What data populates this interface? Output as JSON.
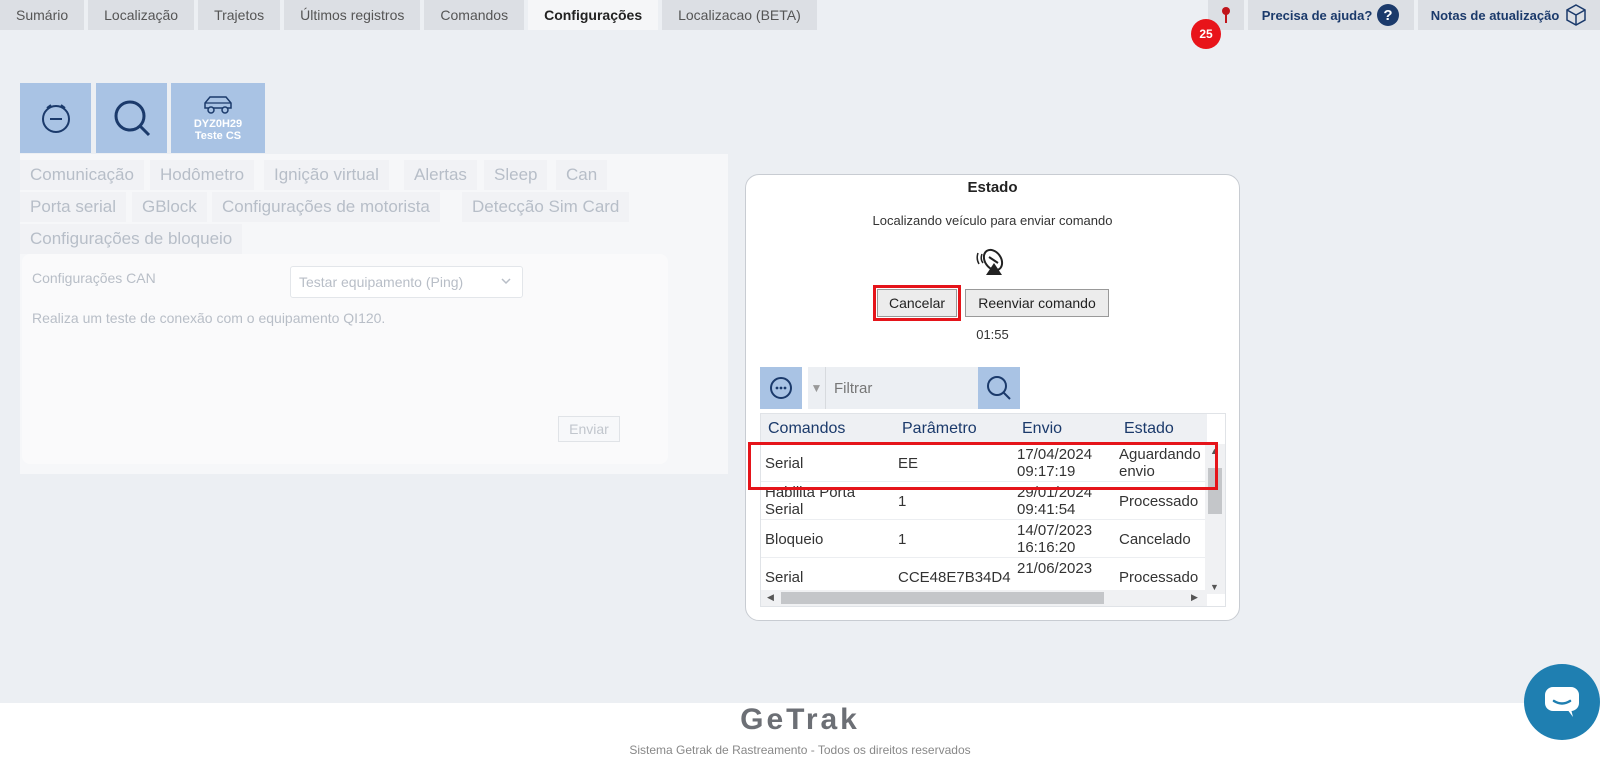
{
  "nav": {
    "tabs": [
      "Sumário",
      "Localização",
      "Trajetos",
      "Últimos registros",
      "Comandos",
      "Configurações",
      "Localizacao (BETA)"
    ],
    "active_tab": "Configurações",
    "notification_count": "25",
    "help_label": "Precisa de ajuda?",
    "notes_label": "Notas de atualização"
  },
  "vehicle": {
    "plate": "DYZ0H29",
    "name": "Teste CS"
  },
  "config": {
    "tabs": [
      "Comunicação",
      "Hodômetro",
      "Ignição virtual",
      "Alertas",
      "Sleep",
      "Can",
      "Porta serial",
      "GBlock",
      "Configurações de motorista",
      "Detecção Sim Card",
      "Configurações de bloqueio"
    ],
    "section_label": "Configurações CAN",
    "select_value": "Testar equipamento (Ping)",
    "description": "Realiza um teste de conexão com o equipamento QI120.",
    "send_label": "Enviar"
  },
  "modal": {
    "title": "Estado",
    "message": "Localizando veículo para enviar comando",
    "cancel_label": "Cancelar",
    "resend_label": "Reenviar comando",
    "timer": "01:55",
    "filter_placeholder": "Filtrar",
    "columns": [
      "Comandos",
      "Parâmetro",
      "Envio",
      "Estado"
    ],
    "rows": [
      {
        "command": "Serial",
        "param": "EE",
        "date": "17/04/2024",
        "time": "09:17:19",
        "state": "Aguardando",
        "state2": "envio"
      },
      {
        "command": "Habilita Porta",
        "command2": "Serial",
        "param": "1",
        "date": "29/01/2024",
        "time": "09:41:54",
        "state": "Processado",
        "state2": ""
      },
      {
        "command": "Bloqueio",
        "param": "1",
        "date": "14/07/2023",
        "time": "16:16:20",
        "state": "Cancelado",
        "state2": ""
      },
      {
        "command": "Serial",
        "param": "CCE48E7B34D4",
        "date": "21/06/2023",
        "time": "",
        "state": "Processado",
        "state2": ""
      }
    ]
  },
  "footer": {
    "logo": "GeTrak",
    "copyright": "Sistema Getrak de Rastreamento - Todos os direitos reservados"
  },
  "colors": {
    "accent": "#a9c3e4",
    "highlight": "#e5141a",
    "badge": "#e8141a",
    "chat": "#1f7fb1",
    "nav_text": "#1b3a6b"
  }
}
